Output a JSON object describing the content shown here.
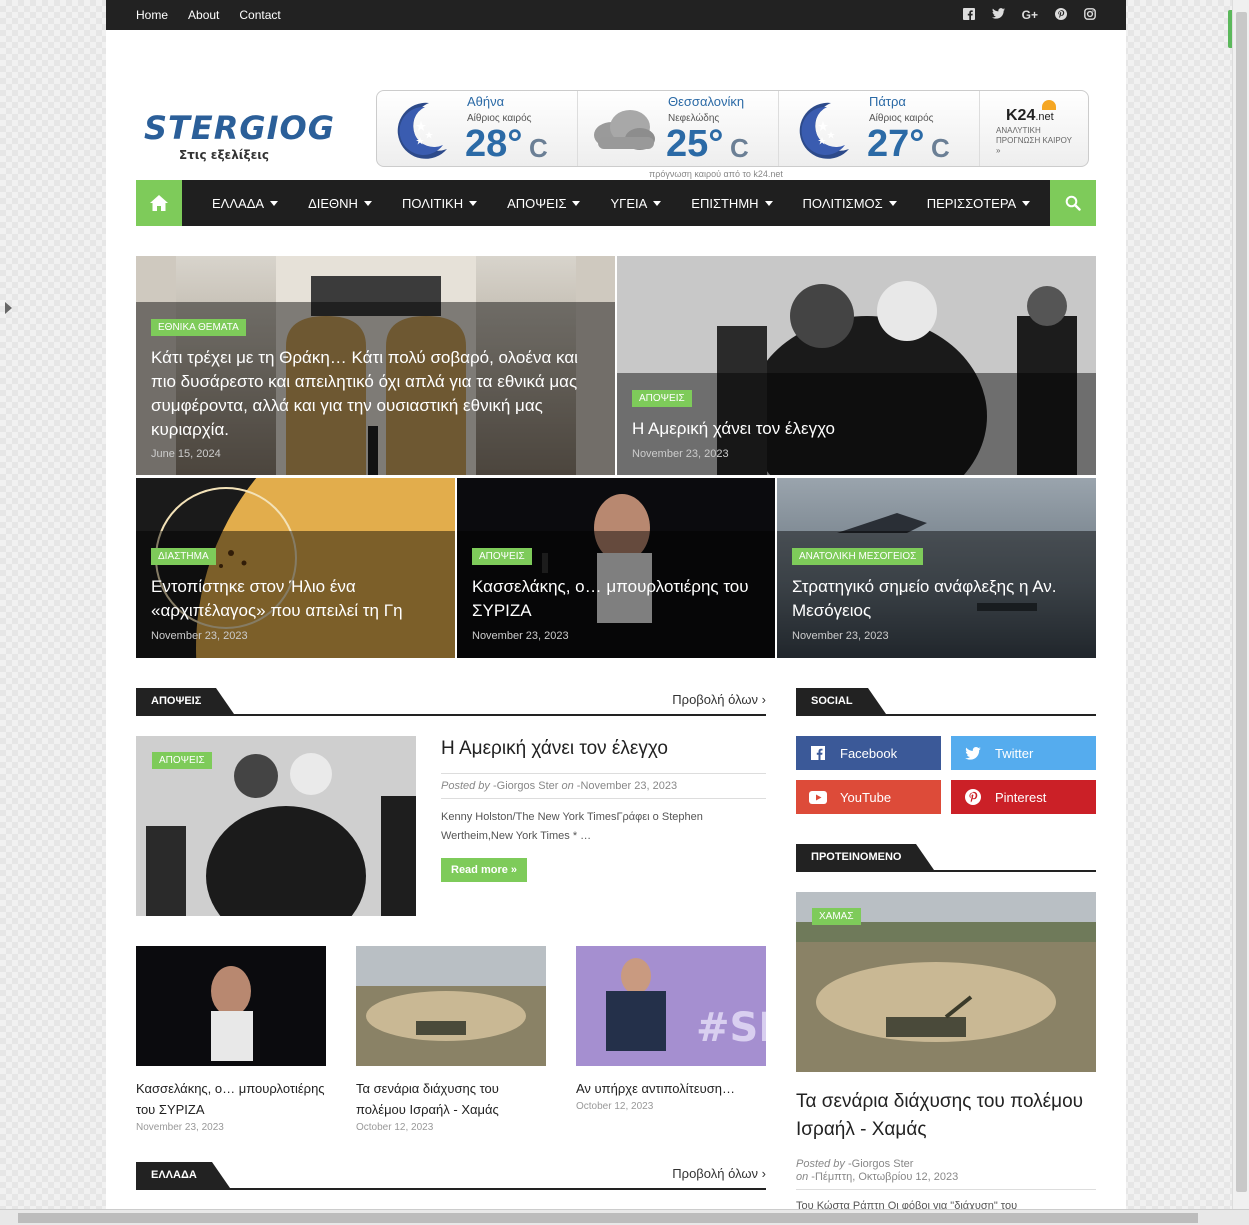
{
  "topbar": {
    "links": [
      "Home",
      "About",
      "Contact"
    ],
    "social_icons": [
      "facebook-icon",
      "twitter-icon",
      "google-plus-icon",
      "pinterest-icon",
      "instagram-icon"
    ]
  },
  "logo": {
    "text": "STERGIOG",
    "tagline": "Στις εξελίξεις"
  },
  "weather": {
    "cities": [
      {
        "name": "Αθήνα",
        "condition": "Αίθριος καιρός",
        "temp": "28°",
        "unit": "C",
        "icon": "moon-icon"
      },
      {
        "name": "Θεσσαλονίκη",
        "condition": "Νεφελώδης",
        "temp": "25°",
        "unit": "C",
        "icon": "cloud-icon"
      },
      {
        "name": "Πάτρα",
        "condition": "Αίθριος καιρός",
        "temp": "27°",
        "unit": "C",
        "icon": "moon-icon"
      }
    ],
    "provider_logo": "K24",
    "provider_suffix": ".net",
    "provider_text": "ΑΝΑΛΥΤΙΚΗ ΠΡΟΓΝΩΣΗ ΚΑΙΡΟΥ »",
    "credit": "πρόγνωση καιρού από το k24.net"
  },
  "nav": {
    "items": [
      "ΕΛΛΑΔΑ",
      "ΔΙΕΘΝΗ",
      "ΠΟΛΙΤΙΚΗ",
      "ΑΠΟΨΕΙΣ",
      "ΥΓΕΙΑ",
      "ΕΠΙΣΤΗΜΗ",
      "ΠΟΛΙΤΙΣΜΟΣ",
      "ΠΕΡΙΣΣΟΤΕΡΑ"
    ]
  },
  "featured": [
    {
      "category": "ΕΘΝΙΚΑ ΘΕΜΑΤΑ",
      "title": "Κάτι τρέχει με τη Θράκη… Κάτι πολύ σοβαρό, ολοένα και πιο δυσάρεστο και απειλητικό όχι απλά για τα εθνικά μας συμφέροντα, αλλά και για την ουσιαστική εθνική μας κυριαρχία.",
      "date": "June 15, 2024"
    },
    {
      "category": "ΑΠΟΨΕΙΣ",
      "title": "Η Αμερική χάνει τον έλεγχο",
      "date": "November 23, 2023"
    },
    {
      "category": "ΔΙΑΣΤΗΜΑ",
      "title": "Εντοπίστηκε στον Ήλιο ένα «αρχιπέλαγος» που απειλεί τη Γη",
      "date": "November 23, 2023"
    },
    {
      "category": "ΑΠΟΨΕΙΣ",
      "title": "Κασσελάκης, ο… μπουρλοτιέρης του ΣΥΡΙΖΑ",
      "date": "November 23, 2023"
    },
    {
      "category": "ΑΝΑΤΟΛΙΚΗ ΜΕΣΟΓΕΙΟΣ",
      "title": "Στρατηγικό σημείο ανάφλεξης η Αν. Μεσόγειος",
      "date": "November 23, 2023"
    }
  ],
  "opinions": {
    "heading": "ΑΠΟΨΕΙΣ",
    "view_all": "Προβολή όλων",
    "main": {
      "category": "ΑΠΟΨΕΙΣ",
      "title": "Η Αμερική χάνει τον έλεγχο",
      "posted_by_label": "Posted by",
      "author": "Giorgos Ster",
      "on_label": "on",
      "date": "November 23, 2023",
      "excerpt": "Kenny Holston/The New York TimesΓράφει ο Stephen Wertheim,New York Times *            …",
      "read_more": "Read more »"
    },
    "small": [
      {
        "title": "Κασσελάκης, ο… μπουρλοτιέρης του ΣΥΡΙΖΑ",
        "date": "November 23, 2023"
      },
      {
        "title": "Τα σενάρια διάχυσης του πολέμου Ισραήλ - Χαμάς",
        "date": "October 12, 2023"
      },
      {
        "title": "Αν υπήρχε αντιπολίτευση…",
        "date": "October 12, 2023"
      }
    ]
  },
  "greece": {
    "heading": "ΕΛΛΑΔΑ",
    "view_all": "Προβολή όλων"
  },
  "sidebar": {
    "social_heading": "SOCIAL",
    "social": [
      {
        "label": "Facebook",
        "color": "#3b5998",
        "icon": "facebook-icon"
      },
      {
        "label": "Twitter",
        "color": "#55acee",
        "icon": "twitter-icon"
      },
      {
        "label": "YouTube",
        "color": "#dd4b39",
        "icon": "youtube-icon"
      },
      {
        "label": "Pinterest",
        "color": "#cb2027",
        "icon": "pinterest-icon"
      }
    ],
    "featured_heading": "ΠΡΟΤΕΙΝΟΜΕΝΟ",
    "featured": {
      "category": "ΧΑΜΑΣ",
      "title": "Τα σενάρια διάχυσης του πολέμου Ισραήλ - Χαμάς",
      "posted_by_label": "Posted by",
      "author": "Giorgos Ster",
      "on_label": "on",
      "date": "Πέμπτη, Οκτωβρίου 12, 2023",
      "excerpt": "Του Κώστα Ράπτη Οι φόβοι για \"διάχυση\" του"
    }
  },
  "colors": {
    "accent": "#7ecb5a",
    "dark": "#222222",
    "link": "#2b6aa6"
  }
}
